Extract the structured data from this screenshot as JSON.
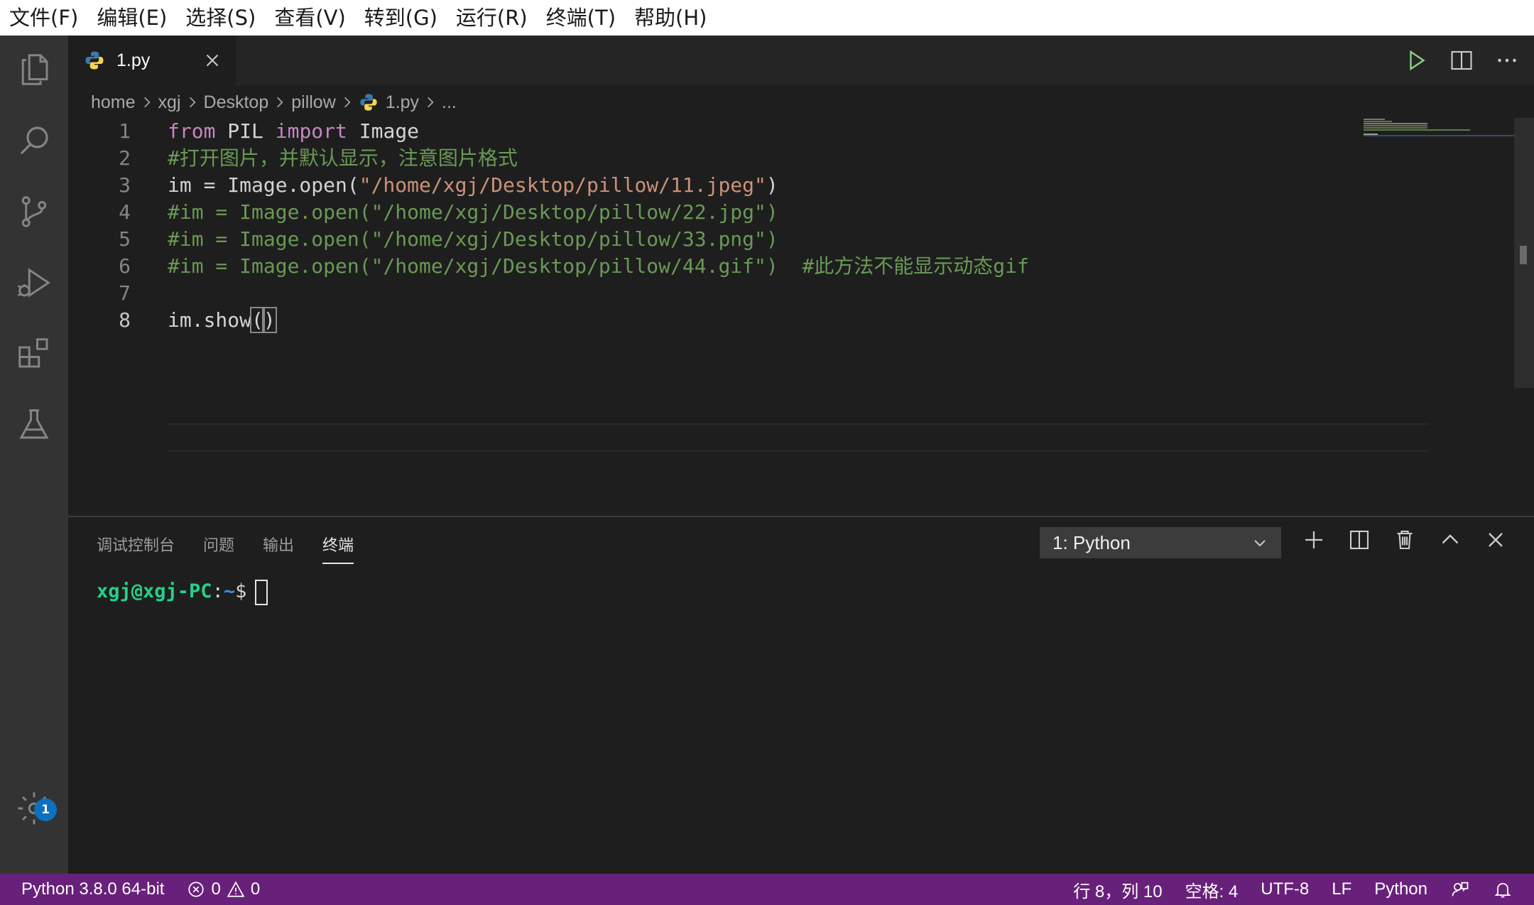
{
  "menubar": [
    "文件(F)",
    "编辑(E)",
    "选择(S)",
    "查看(V)",
    "转到(G)",
    "运行(R)",
    "终端(T)",
    "帮助(H)"
  ],
  "activity_bar": {
    "items": [
      "files-icon",
      "search-icon",
      "source-control-icon",
      "run-debug-icon",
      "extensions-icon",
      "testing-icon"
    ],
    "manage_icon": "gear-icon",
    "manage_badge": "1"
  },
  "tab": {
    "label": "1.py",
    "icon": "python-file-icon"
  },
  "breadcrumb": [
    "home",
    "xgj",
    "Desktop",
    "pillow",
    "1.py",
    "..."
  ],
  "editor": {
    "lines": [
      {
        "n": "1",
        "tokens": [
          {
            "t": "from",
            "c": "kw"
          },
          {
            "t": " PIL ",
            "c": ""
          },
          {
            "t": "import",
            "c": "kw"
          },
          {
            "t": " Image",
            "c": ""
          }
        ]
      },
      {
        "n": "2",
        "tokens": [
          {
            "t": "#打开图片，并默认显示，注意图片格式",
            "c": "cm"
          }
        ]
      },
      {
        "n": "3",
        "tokens": [
          {
            "t": "im = Image.open(",
            "c": ""
          },
          {
            "t": "\"/home/xgj/Desktop/pillow/11.jpeg\"",
            "c": "str"
          },
          {
            "t": ")",
            "c": ""
          }
        ]
      },
      {
        "n": "4",
        "tokens": [
          {
            "t": "#im = Image.open(\"/home/xgj/Desktop/pillow/22.jpg\")",
            "c": "cm"
          }
        ]
      },
      {
        "n": "5",
        "tokens": [
          {
            "t": "#im = Image.open(\"/home/xgj/Desktop/pillow/33.png\")",
            "c": "cm"
          }
        ]
      },
      {
        "n": "6",
        "tokens": [
          {
            "t": "#im = Image.open(\"/home/xgj/Desktop/pillow/44.gif\")  #此方法不能显示动态gif",
            "c": "cm"
          }
        ]
      },
      {
        "n": "7",
        "tokens": []
      },
      {
        "n": "8",
        "tokens": [
          {
            "t": "im.show",
            "c": ""
          },
          {
            "t": "(",
            "c": "br"
          },
          {
            "t": ")",
            "c": "br"
          }
        ]
      }
    ]
  },
  "panel": {
    "tabs": [
      "调试控制台",
      "问题",
      "输出",
      "终端"
    ],
    "active_tab": "终端",
    "terminal_select": "1: Python",
    "prompt_user": "xgj@xgj-PC",
    "prompt_sep": ":",
    "prompt_path": "~",
    "prompt_dollar": "$"
  },
  "statusbar": {
    "interpreter": "Python 3.8.0 64-bit",
    "errors": "0",
    "warnings": "0",
    "position": "行 8，列 10",
    "indent": "空格: 4",
    "encoding": "UTF-8",
    "eol": "LF",
    "language": "Python"
  },
  "colors": {
    "statusbar_bg": "#68217a",
    "editor_bg": "#1e1e1e",
    "keyword": "#c586c0",
    "string": "#ce9178",
    "comment": "#6a9955",
    "terminal_user": "#23d18b",
    "terminal_path": "#3b8eea"
  }
}
